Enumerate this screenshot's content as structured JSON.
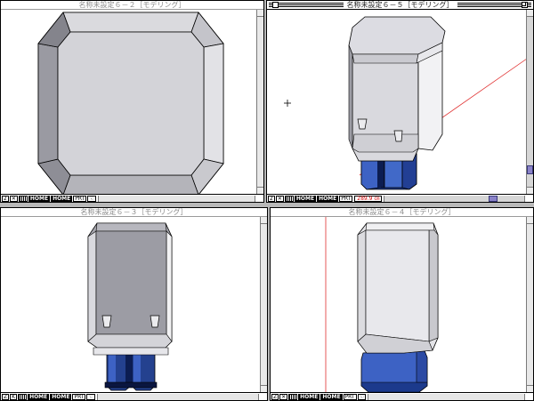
{
  "windows": [
    {
      "id": "w1",
      "title": "名称未設定６－２［モデリング］",
      "active": false,
      "status": {
        "icon_a": "2",
        "icon_b": "✕",
        "home1": "HOME",
        "home2": "HOME",
        "mode": "PRT"
      }
    },
    {
      "id": "w2",
      "title": "名称未設定６－５［モデリング］",
      "active": true,
      "status": {
        "icon_a": "2",
        "icon_b": "✕",
        "home1": "HOME",
        "home2": "HOME",
        "mode": "PRT",
        "readout": "289.9 ㎝"
      }
    },
    {
      "id": "w3",
      "title": "名称未設定６－３［モデリング］",
      "active": false,
      "status": {
        "icon_a": "Z",
        "icon_b": "K",
        "home1": "HOME",
        "home2": "HOME",
        "mode": "PRT"
      }
    },
    {
      "id": "w4",
      "title": "名称未設定６－４［モデリング］",
      "active": false,
      "status": {
        "icon_a": "Z",
        "icon_b": "✕",
        "home1": "HOME",
        "home2": "HOME",
        "mode": "PRT"
      }
    }
  ],
  "icons": [
    "close-box-icon",
    "zoom-box-icon",
    "grid-icon",
    "hand-icon",
    "crosshair-icon"
  ],
  "colors": {
    "body_light": "#d7d7dc",
    "body_mid": "#a9a9b0",
    "body_dark": "#7c7c84",
    "leg_blue": "#3a5fb8",
    "leg_dark": "#0c1d52",
    "guide_red": "#e03030",
    "scroll_thumb": "#8a82c8"
  }
}
